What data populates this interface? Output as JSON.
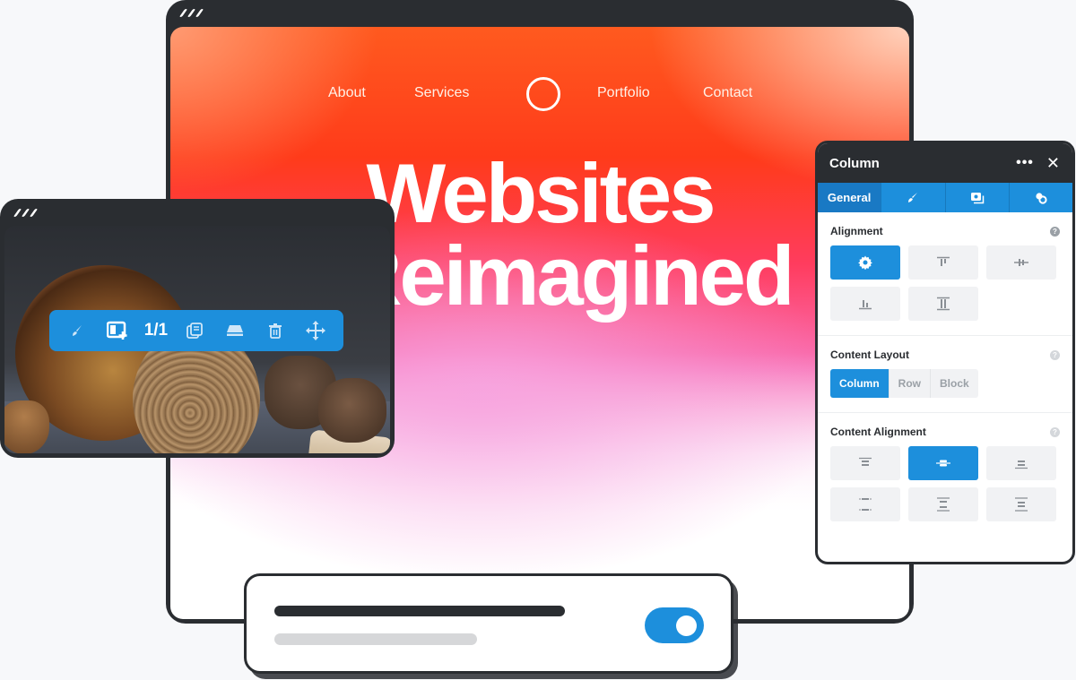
{
  "main_window": {
    "nav": {
      "links": [
        {
          "label": "About"
        },
        {
          "label": "Services"
        },
        {
          "label": "Portfolio"
        },
        {
          "label": "Contact"
        }
      ],
      "logo_icon": "circle-logo-icon"
    },
    "hero": {
      "line1": "Websites",
      "line2": "Reimagined"
    }
  },
  "image_window": {
    "image_description": "wooden bowls and wood slab still life",
    "toolbar": {
      "items": [
        {
          "icon": "brush-icon"
        },
        {
          "icon": "add-column-icon"
        },
        {
          "label": "1/1"
        },
        {
          "icon": "duplicate-icon"
        },
        {
          "icon": "save-icon"
        },
        {
          "icon": "trash-icon"
        },
        {
          "icon": "move-icon"
        }
      ]
    }
  },
  "panel": {
    "title": "Column",
    "more_icon": "more-horizontal-icon",
    "close_icon": "close-icon",
    "tabs": [
      {
        "label": "General",
        "active": true
      },
      {
        "icon": "brush-icon"
      },
      {
        "icon": "image-stack-icon"
      },
      {
        "icon": "advanced-icon"
      }
    ],
    "sections": {
      "alignment": {
        "title": "Alignment",
        "options": [
          "settings",
          "top",
          "center",
          "bottom",
          "stretch"
        ],
        "selected": "settings"
      },
      "content_layout": {
        "title": "Content Layout",
        "options": [
          "Column",
          "Row",
          "Block"
        ],
        "selected": "Column"
      },
      "content_alignment": {
        "title": "Content Alignment",
        "options": [
          "top",
          "center",
          "bottom",
          "space-around",
          "space-between",
          "space-evenly"
        ],
        "selected": "center"
      }
    }
  },
  "toggle_card": {
    "toggle_on": true
  },
  "colors": {
    "accent": "#1d8fdc",
    "frame": "#2a2d31",
    "background": "#f7f8fa"
  }
}
